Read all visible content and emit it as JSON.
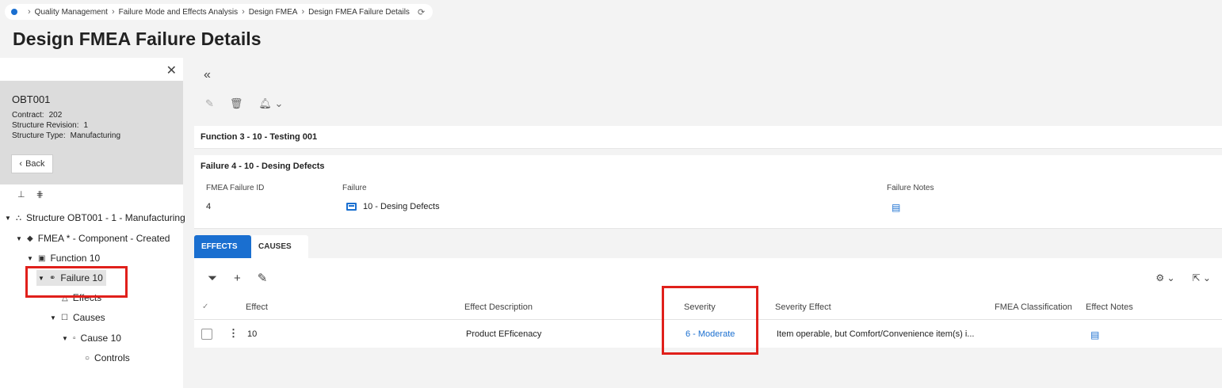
{
  "breadcrumb": {
    "items": [
      "Quality Management",
      "Failure Mode and Effects Analysis",
      "Design FMEA",
      "Design FMEA Failure Details"
    ]
  },
  "page_title": "Design FMEA Failure Details",
  "left_panel": {
    "code": "OBT001",
    "contract_label": "Contract:",
    "contract_value": "202",
    "revision_label": "Structure Revision:",
    "revision_value": "1",
    "type_label": "Structure Type:",
    "type_value": "Manufacturing",
    "back_label": "Back",
    "tree": {
      "structure": "Structure OBT001 - 1 - Manufacturing",
      "fmea": "FMEA * - Component - Created",
      "function": "Function 10",
      "failure": "Failure 10",
      "effects": "Effects",
      "causes": "Causes",
      "cause": "Cause 10",
      "controls": "Controls"
    }
  },
  "function_card": {
    "title": "Function 3 - 10 - Testing 001"
  },
  "failure_card": {
    "title": "Failure 4 - 10 - Desing Defects",
    "id_label": "FMEA Failure ID",
    "id_value": "4",
    "failure_label": "Failure",
    "failure_value": "10 - Desing Defects",
    "notes_label": "Failure Notes"
  },
  "tabs": {
    "effects": "EFFECTS",
    "causes": "CAUSES"
  },
  "grid": {
    "columns": [
      "Effect",
      "Effect Description",
      "Severity",
      "Severity Effect",
      "FMEA Classification",
      "Effect Notes"
    ],
    "rows": [
      {
        "effect": "10",
        "description": "Product EFficenacy",
        "severity": "6 - Moderate",
        "severity_effect": "Item operable, but Comfort/Convenience item(s) i...",
        "classification": ""
      }
    ]
  },
  "colors": {
    "accent": "#1a6fd0",
    "highlight": "#e0201b"
  }
}
